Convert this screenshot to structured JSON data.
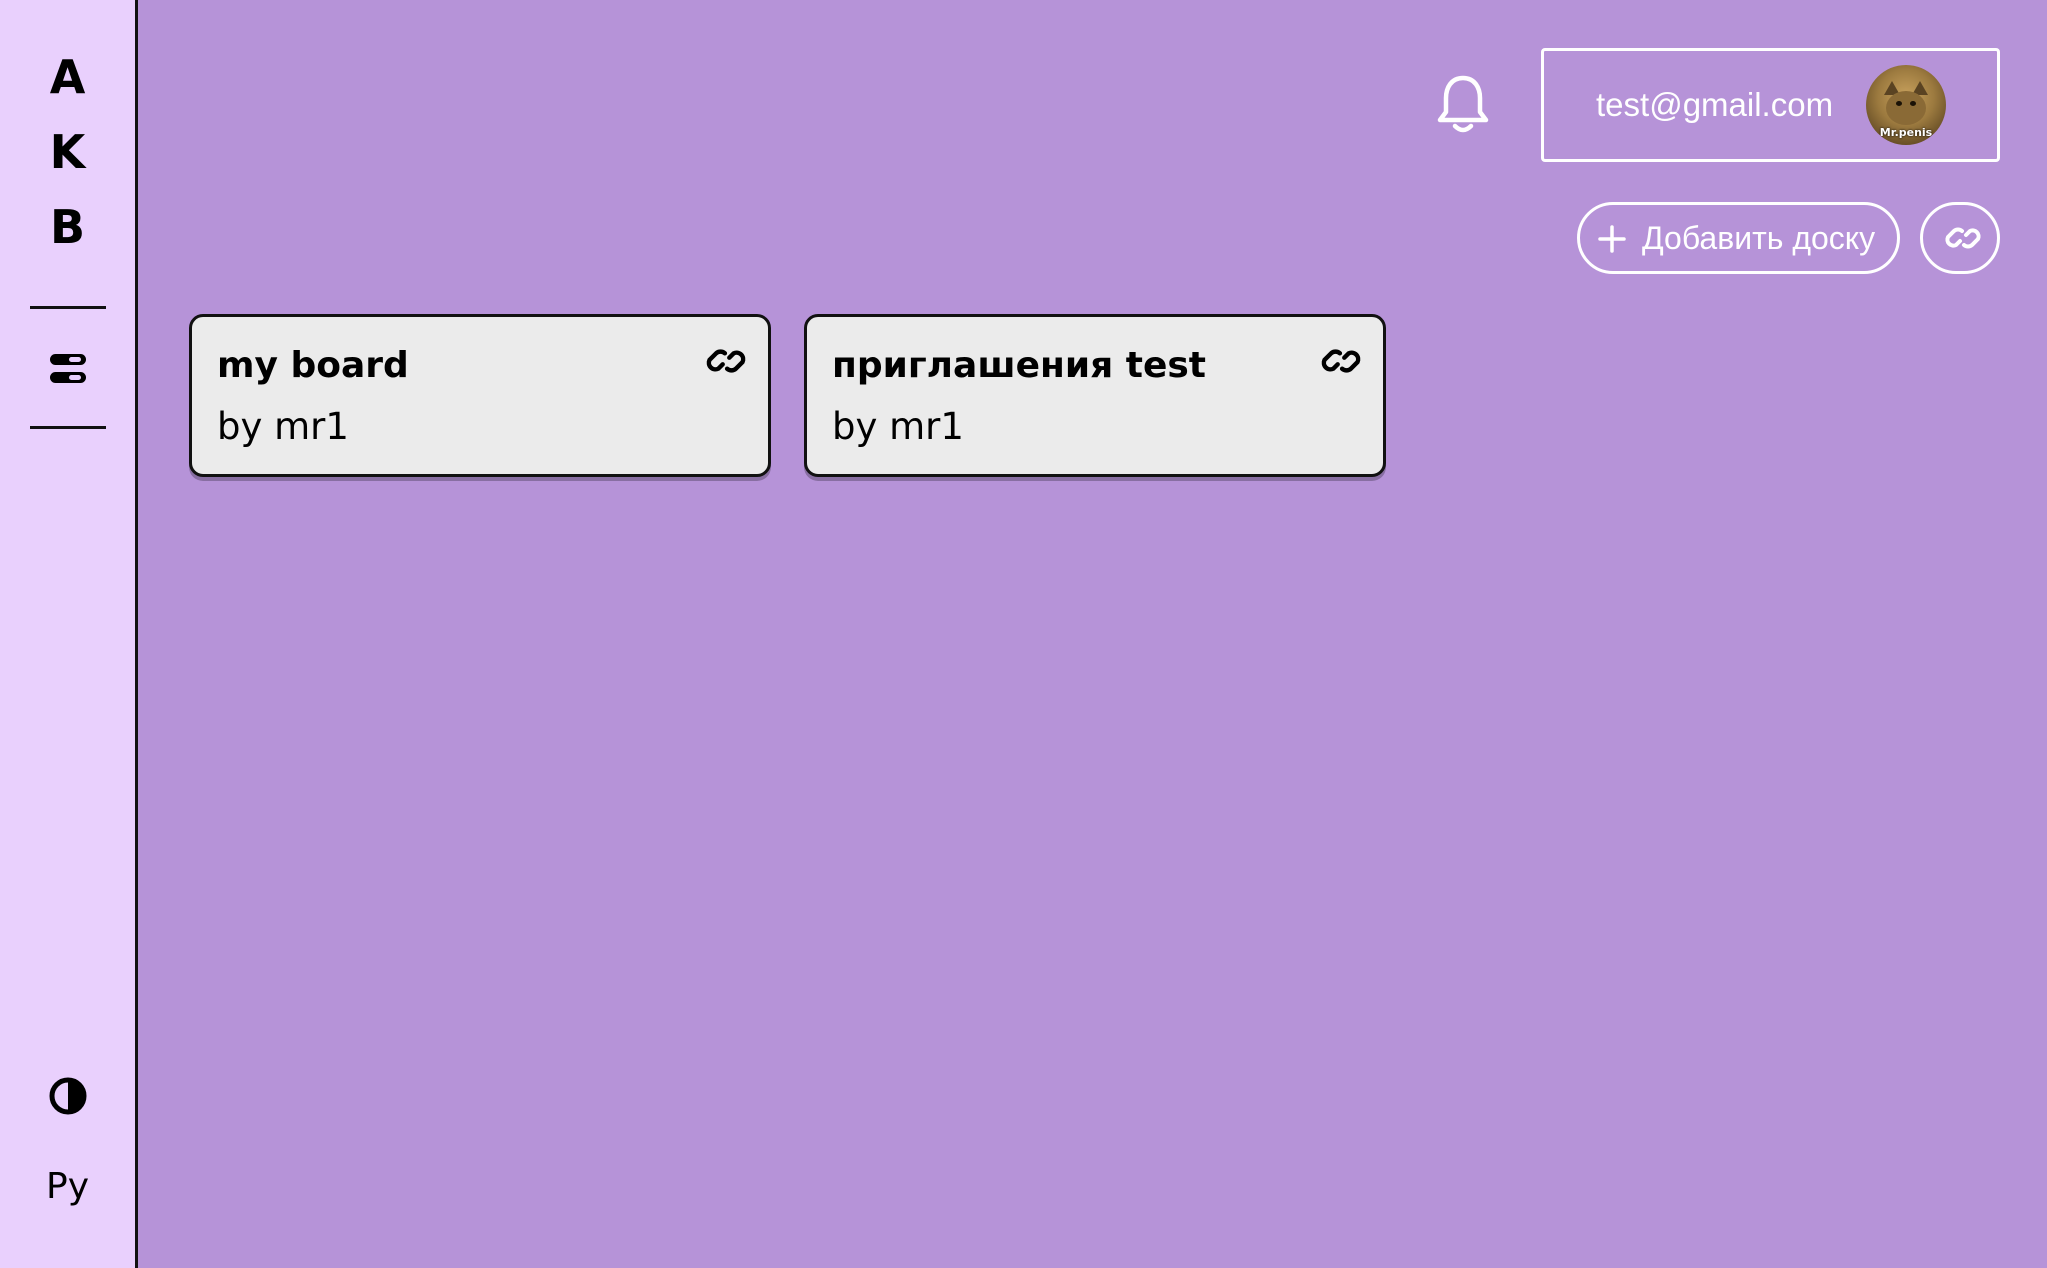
{
  "sidebar": {
    "logo_letters": [
      "A",
      "K",
      "B"
    ],
    "language": "Ру",
    "nav_icon": "boards-icon",
    "theme_icon": "contrast-icon"
  },
  "header": {
    "user_email": "test@gmail.com",
    "avatar_caption": "Mr.penis",
    "bell_icon": "bell-icon"
  },
  "actions": {
    "add_board_label": "Добавить доску",
    "add_icon": "plus-icon",
    "join_icon": "link-icon"
  },
  "boards": [
    {
      "title": "my board",
      "author": "by mr1"
    },
    {
      "title": "приглашения test",
      "author": "by mr1"
    }
  ],
  "colors": {
    "background": "#b693d8",
    "sidebar": "#e9d0fd",
    "card": "#ebebeb",
    "outline": "#ffffff"
  }
}
